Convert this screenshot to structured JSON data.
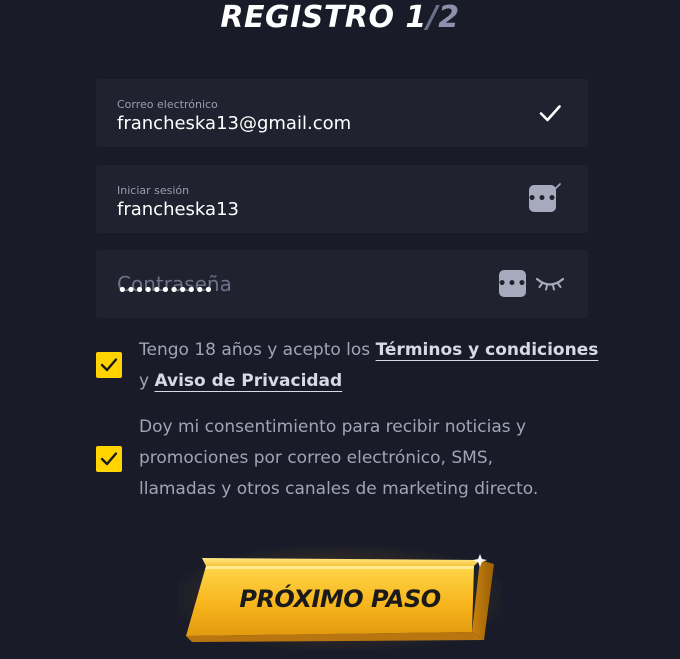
{
  "header": {
    "title_main": "REGISTRO 1",
    "title_sep": "/",
    "title_step": "2"
  },
  "email": {
    "label": "Correo electrónico",
    "value": "francheska13@gmail.com",
    "icon": "check-icon"
  },
  "login": {
    "label": "Iniciar sesión",
    "value": "francheska13",
    "icon": "password-dots-icon"
  },
  "password": {
    "placeholder": "Contraseña",
    "masked_value": "•••••••••••",
    "icons": [
      "password-dots-icon",
      "eye-closed-icon"
    ]
  },
  "consent_terms": {
    "checked": true,
    "text_before": "Tengo 18 años y acepto los ",
    "terms_link": "Términos y condiciones",
    "text_mid": "y ",
    "privacy_link": "Aviso de Privacidad"
  },
  "consent_marketing": {
    "checked": true,
    "line1": "Doy mi consentimiento para recibir noticias y",
    "line2": "promociones por correo electrónico, SMS,",
    "line3": "llamadas y otros canales de marketing directo."
  },
  "cta": {
    "label": "PRÓXIMO PASO"
  },
  "colors": {
    "background": "#191c28",
    "field": "#20232f",
    "accent": "#ffd400",
    "button": "#f5b21b"
  }
}
